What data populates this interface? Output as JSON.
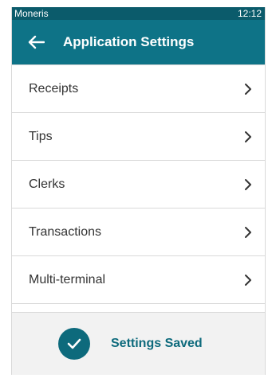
{
  "status_bar": {
    "carrier": "Moneris",
    "time": "12:12"
  },
  "header": {
    "title": "Application Settings",
    "back_icon": "arrow-left-icon"
  },
  "menu": {
    "items": [
      {
        "label": "Receipts"
      },
      {
        "label": "Tips"
      },
      {
        "label": "Clerks"
      },
      {
        "label": "Transactions"
      },
      {
        "label": "Multi-terminal"
      }
    ]
  },
  "toast": {
    "message": "Settings Saved",
    "icon": "checkmark-circle-icon"
  },
  "colors": {
    "header_bg": "#0e7387",
    "status_bg": "#0b5b6b",
    "accent": "#0d6a7c",
    "toast_bg": "#f2f2f2",
    "divider": "#d9d9d9"
  }
}
